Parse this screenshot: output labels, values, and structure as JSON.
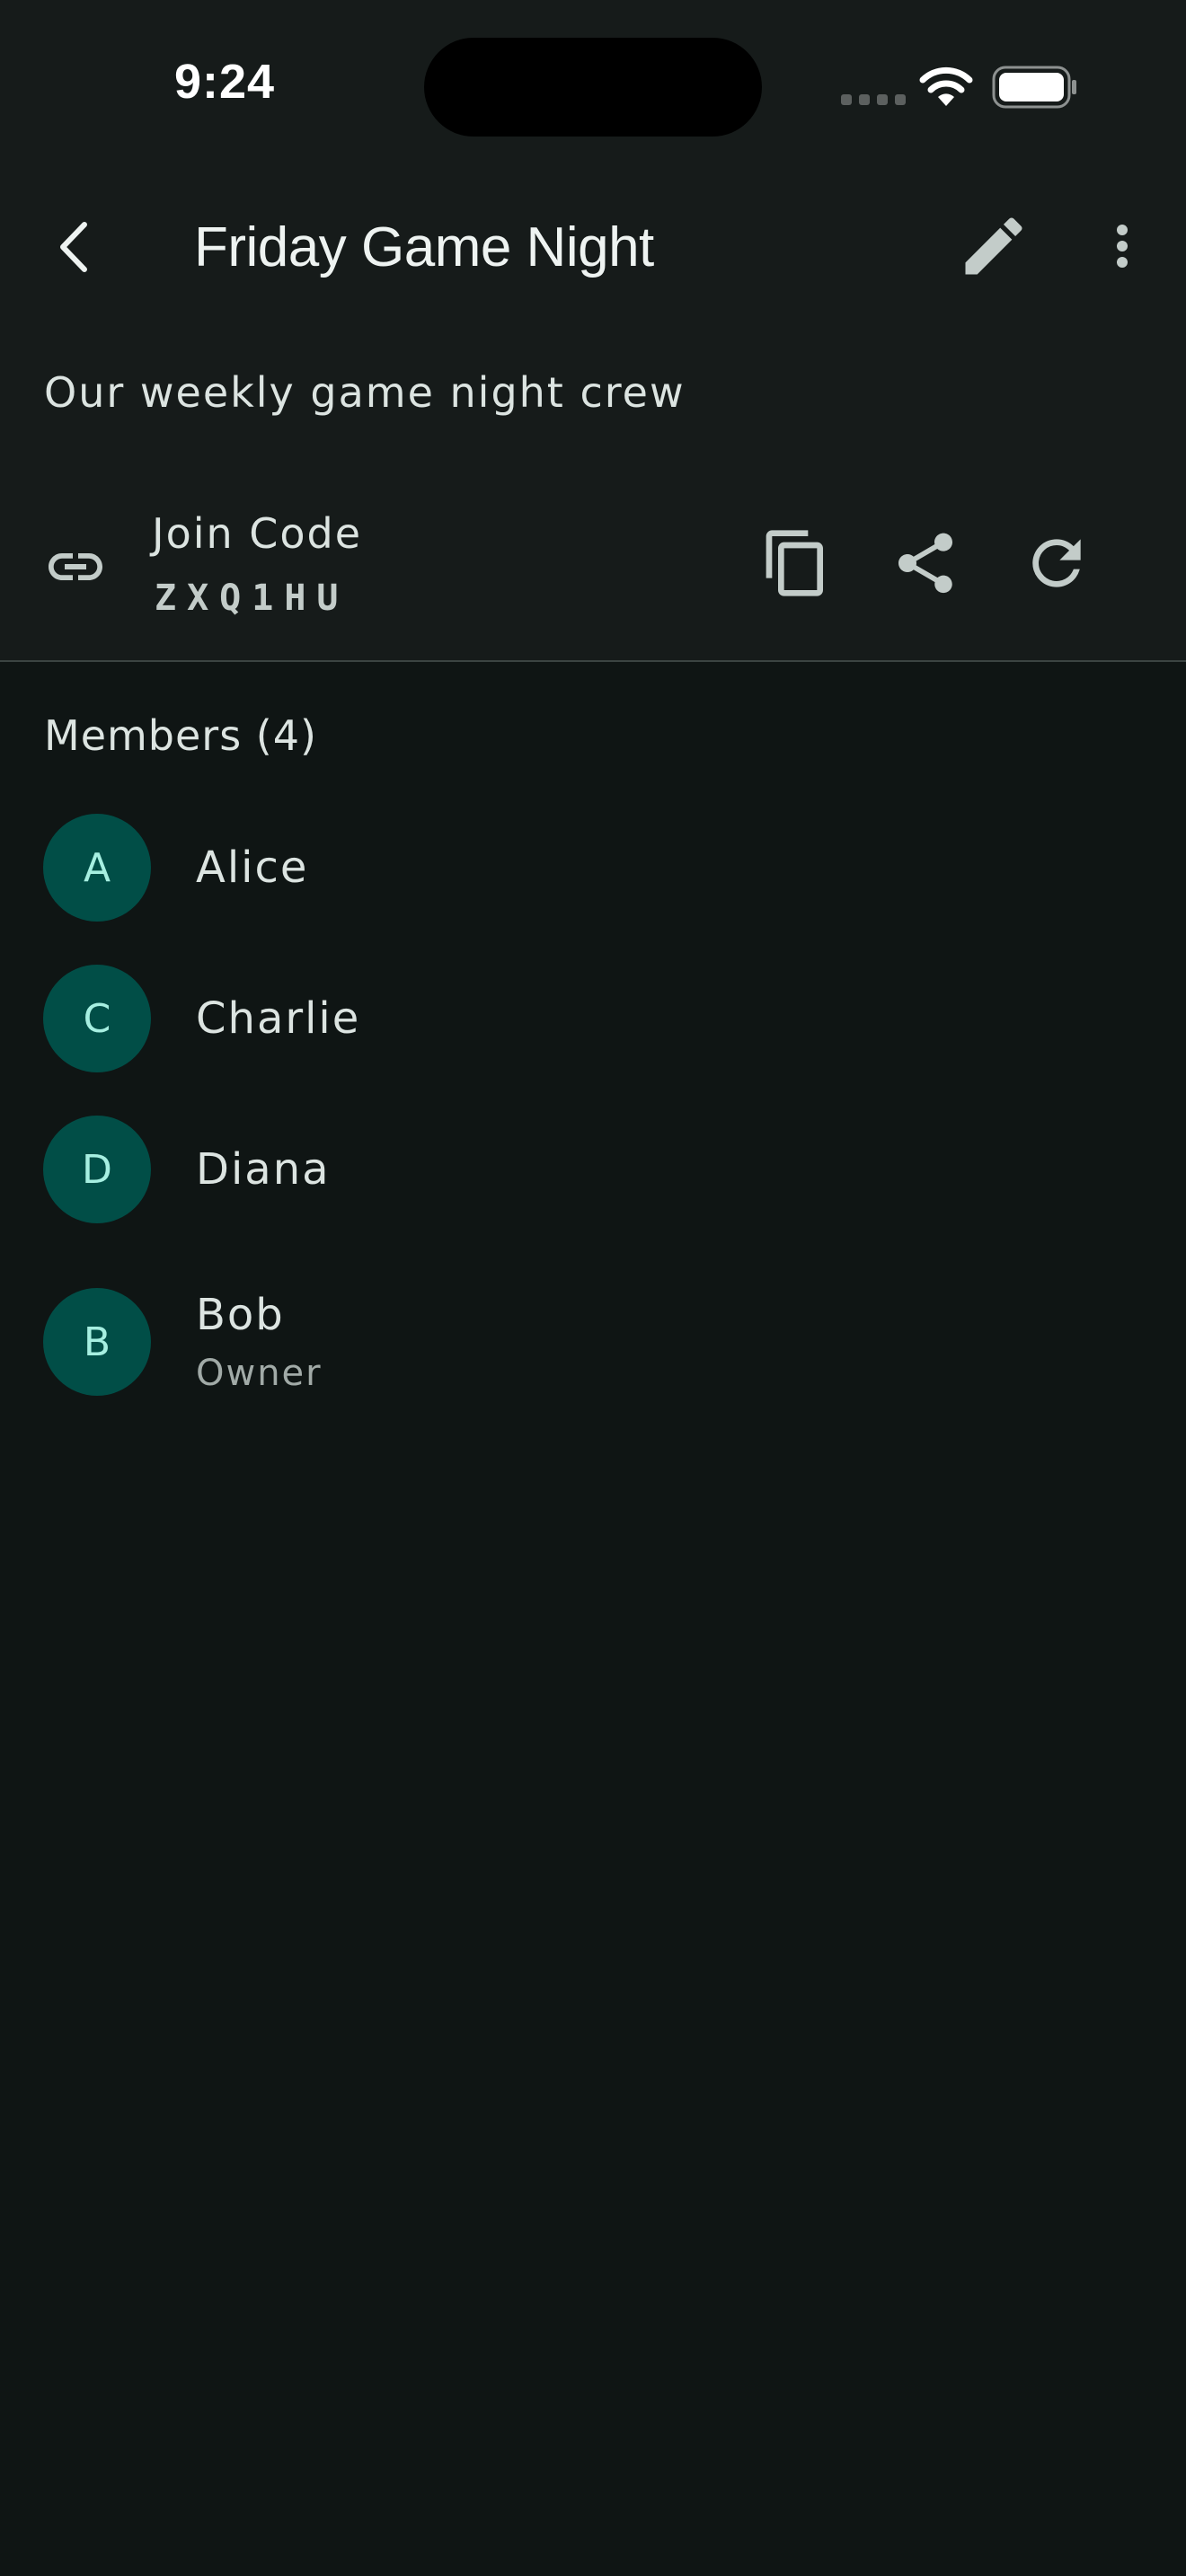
{
  "status_bar": {
    "time": "9:24",
    "icons": [
      "cell-signal-icon",
      "wifi-icon",
      "battery-icon"
    ]
  },
  "header": {
    "title": "Friday Game Night",
    "icons": [
      "back-arrow-icon",
      "pencil-icon",
      "more-vert-icon"
    ]
  },
  "group": {
    "description": "Our weekly game night crew"
  },
  "join": {
    "label": "Join Code",
    "code": "ZXQ1HU",
    "icons": [
      "link-icon",
      "copy-icon",
      "share-icon",
      "refresh-icon"
    ]
  },
  "members": {
    "heading": "Members (4)",
    "items": [
      {
        "initial": "A",
        "name": "Alice",
        "role": ""
      },
      {
        "initial": "C",
        "name": "Charlie",
        "role": ""
      },
      {
        "initial": "D",
        "name": "Diana",
        "role": ""
      },
      {
        "initial": "B",
        "name": "Bob",
        "role": "Owner"
      }
    ]
  },
  "colors": {
    "background": "#0f1514",
    "surface": "#161b1a",
    "avatar_bg": "#014e47",
    "avatar_text": "#a6efe1",
    "divider": "#3b4442"
  }
}
